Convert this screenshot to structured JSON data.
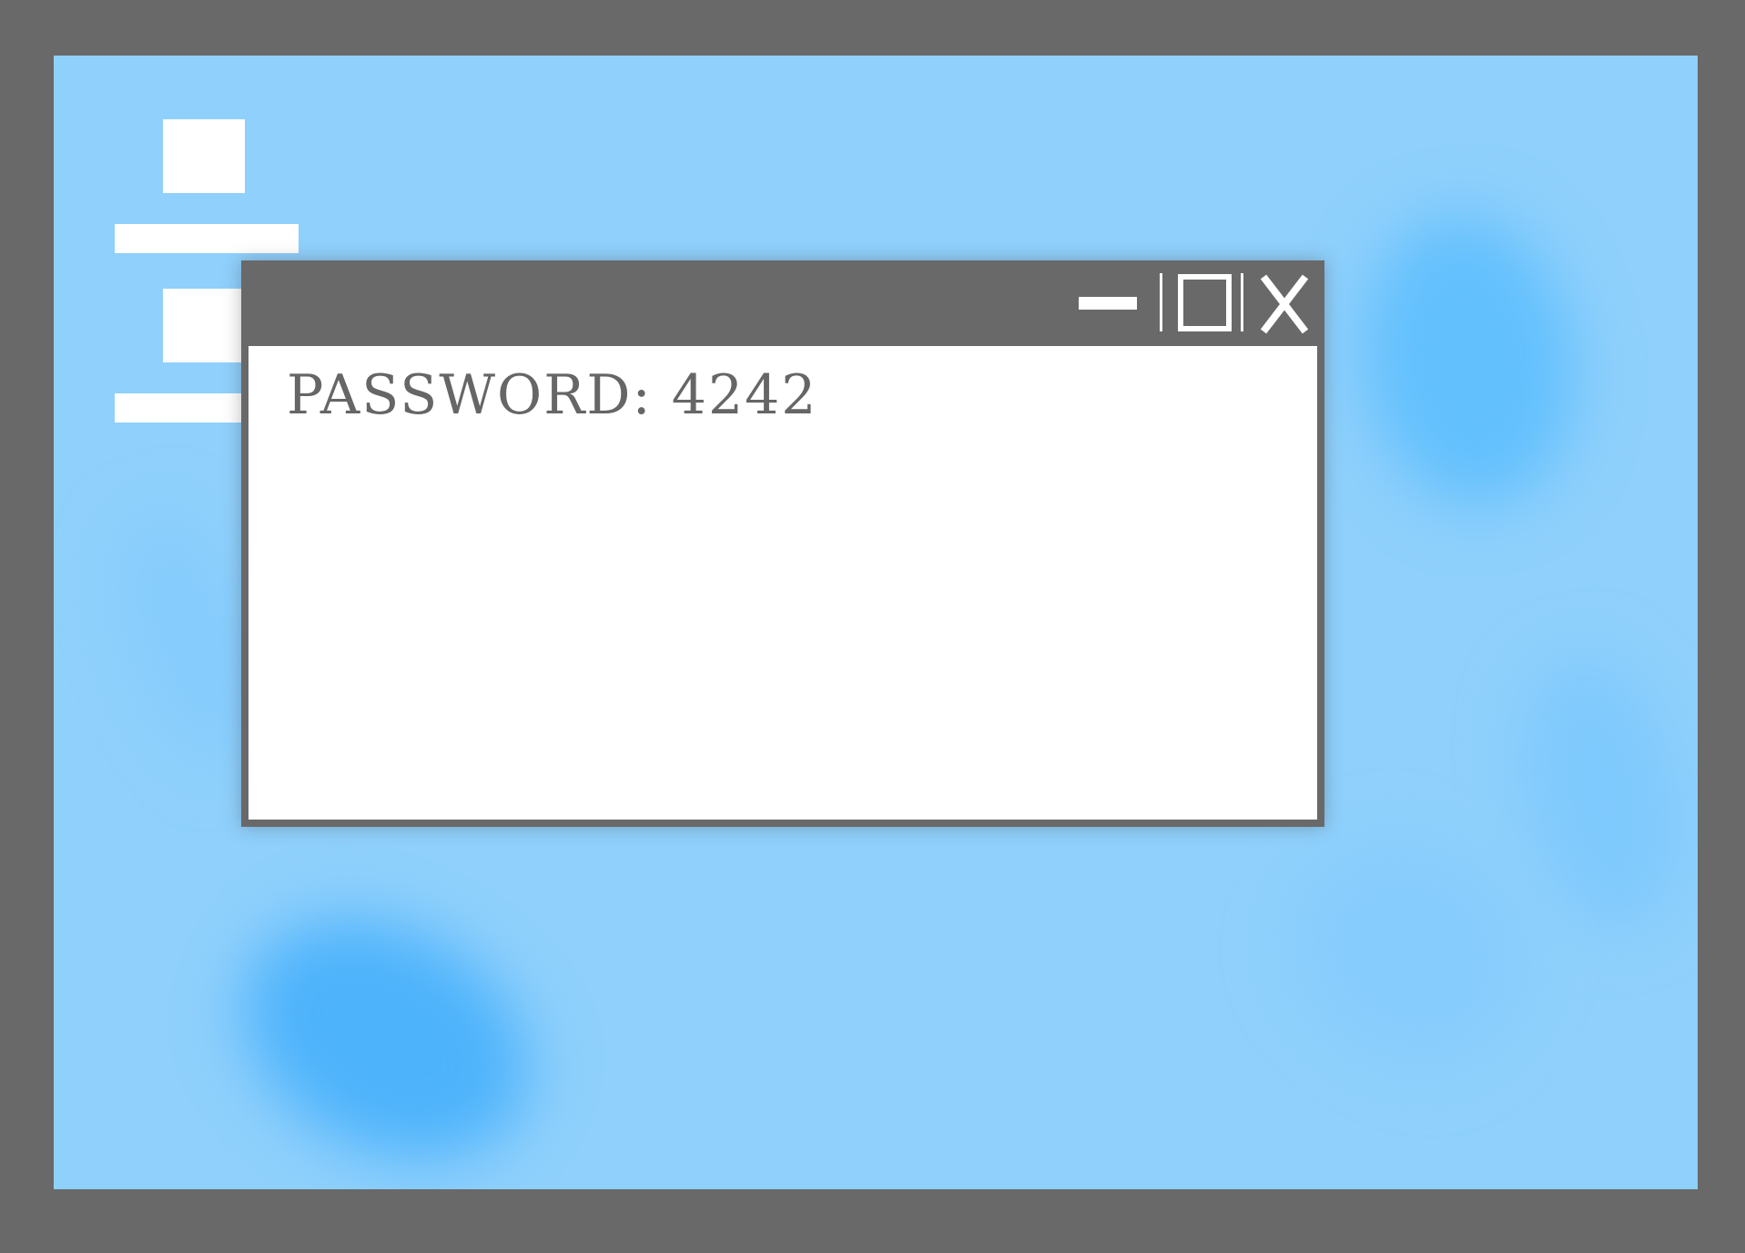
{
  "window": {
    "content_text": "PASSWORD: 4242",
    "controls": {
      "minimize_icon": "minimize-icon",
      "maximize_icon": "maximize-icon",
      "close_icon": "close-icon"
    }
  },
  "desktop": {
    "icons": [
      {
        "icon": "blank-file-icon"
      },
      {
        "icon": "blank-file-icon"
      }
    ]
  },
  "colors": {
    "bezel": "#696969",
    "desktop_background": "#8fd0fc",
    "window_frame": "#696969",
    "window_body": "#ffffff",
    "text": "#666666"
  }
}
